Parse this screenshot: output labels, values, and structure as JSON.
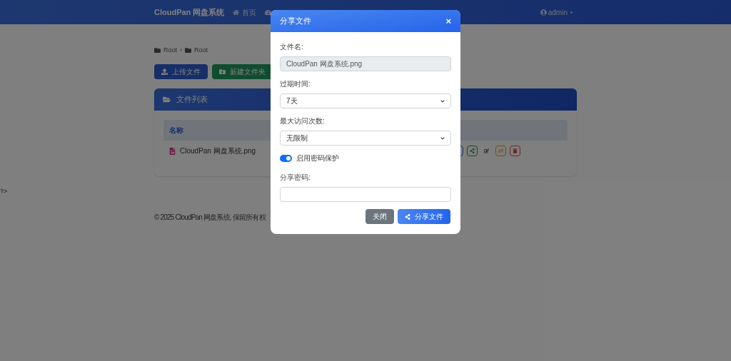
{
  "navbar": {
    "brand": "CloudPan 网盘系统",
    "items": [
      {
        "label": "首页",
        "selected": false
      }
    ],
    "user": "admin"
  },
  "breadcrumb": {
    "separator": "›",
    "items": [
      "Root",
      "Root"
    ]
  },
  "toolbar": [
    {
      "kind": "upload",
      "label": "上传文件"
    },
    {
      "kind": "new_folder",
      "label": "新建文件夹"
    }
  ],
  "file_list": {
    "title": "文件列表",
    "columns": [
      "名称"
    ],
    "rows": [
      {
        "name": "CloudPan 网盘系统.png",
        "actions": [
          {
            "kind": "download"
          },
          {
            "kind": "share"
          },
          {
            "kind": "edit"
          },
          {
            "kind": "move"
          },
          {
            "kind": "delete"
          }
        ]
      }
    ]
  },
  "stray_text": "?>",
  "footer": "© 2025 CloudPan 网盘系统. 保留所有权",
  "modal": {
    "title": "分享文件",
    "close": "×",
    "fields": [
      {
        "kind": "text",
        "label": "文件名:",
        "value": "CloudPan 网盘系统.png",
        "disabled": true
      },
      {
        "kind": "select",
        "label": "过期时间:",
        "value": "7天"
      },
      {
        "kind": "select",
        "label": "最大访问次数:",
        "value": "无限制"
      },
      {
        "kind": "switch",
        "label": "启用密码保护",
        "on": true
      },
      {
        "kind": "text",
        "label": "分享密码:",
        "disabled": false
      }
    ],
    "buttons": [
      {
        "kind": "secondary",
        "label": "关闭"
      },
      {
        "kind": "primary",
        "label": "分享文件"
      }
    ]
  }
}
